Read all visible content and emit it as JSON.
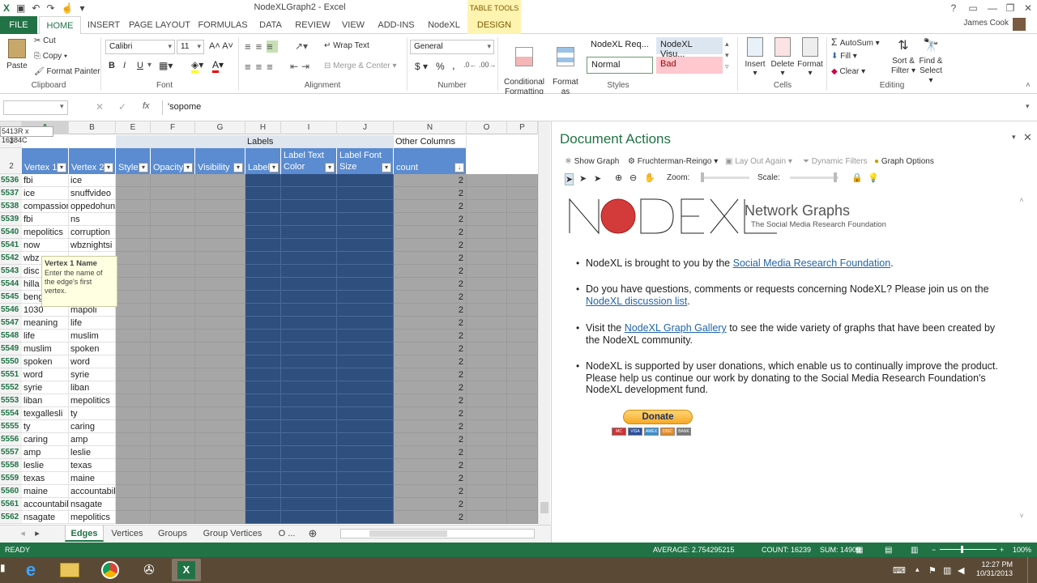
{
  "window": {
    "title": "NodeXLGraph2 - Excel",
    "table_tools": "TABLE TOOLS"
  },
  "tabs": [
    "FILE",
    "HOME",
    "INSERT",
    "PAGE LAYOUT",
    "FORMULAS",
    "DATA",
    "REVIEW",
    "VIEW",
    "ADD-INS",
    "NodeXL",
    "DESIGN"
  ],
  "user": "James Cook",
  "ribbon": {
    "clipboard": {
      "paste": "Paste",
      "cut": "Cut",
      "copy": "Copy",
      "format_painter": "Format Painter",
      "label": "Clipboard"
    },
    "font": {
      "name": "Calibri",
      "size": "11",
      "label": "Font",
      "bold": "B",
      "italic": "I",
      "underline": "U"
    },
    "alignment": {
      "wrap": "Wrap Text",
      "merge": "Merge & Center",
      "label": "Alignment"
    },
    "number": {
      "format": "General",
      "dollar": "$",
      "percent": "%",
      "comma": ",",
      "label": "Number"
    },
    "styles": {
      "cond": "Conditional\nFormatting",
      "format_table": "Format as\nTable",
      "s1": "NodeXL Req...",
      "s2": "NodeXL Visu...",
      "normal": "Normal",
      "bad": "Bad",
      "label": "Styles"
    },
    "cells": {
      "insert": "Insert",
      "delete": "Delete",
      "format": "Format",
      "label": "Cells"
    },
    "editing": {
      "autosum": "AutoSum",
      "fill": "Fill",
      "clear": "Clear",
      "sort": "Sort &\nFilter",
      "find": "Find &\nSelect",
      "label": "Editing"
    }
  },
  "formula_bar": {
    "name_box": "",
    "value": "'sopome",
    "fx": "fx"
  },
  "size_tip": "5413R x 16384C",
  "columns": [
    "A",
    "B",
    "E",
    "F",
    "G",
    "H",
    "I",
    "J",
    "N",
    "O",
    "P"
  ],
  "group_headers": {
    "labels": "Labels",
    "other": "Other Columns"
  },
  "table_headers": [
    "Vertex 1",
    "Vertex 2",
    "Style",
    "Opacity",
    "Visibility",
    "Label",
    "Label Text Color",
    "Label Font Size",
    "count"
  ],
  "rows": [
    [
      "5536",
      "fbi",
      "ice",
      "2"
    ],
    [
      "5537",
      "ice",
      "snuffvideo",
      "2"
    ],
    [
      "5538",
      "compassion",
      "oppedohun",
      "2"
    ],
    [
      "5539",
      "fbi",
      "ns",
      "2"
    ],
    [
      "5540",
      "mepolitics",
      "corruption",
      "2"
    ],
    [
      "5541",
      "now",
      "wbznightsi",
      "2"
    ],
    [
      "5542",
      "wbz",
      "",
      "2"
    ],
    [
      "5543",
      "disc",
      "",
      "2"
    ],
    [
      "5544",
      "hilla",
      "",
      "2"
    ],
    [
      "5545",
      "beng",
      "",
      "2"
    ],
    [
      "5546",
      "1030",
      "mapoli",
      "2"
    ],
    [
      "5547",
      "meaning",
      "life",
      "2"
    ],
    [
      "5548",
      "life",
      "muslim",
      "2"
    ],
    [
      "5549",
      "muslim",
      "spoken",
      "2"
    ],
    [
      "5550",
      "spoken",
      "word",
      "2"
    ],
    [
      "5551",
      "word",
      "syrie",
      "2"
    ],
    [
      "5552",
      "syrie",
      "liban",
      "2"
    ],
    [
      "5553",
      "liban",
      "mepolitics",
      "2"
    ],
    [
      "5554",
      "texgallesli",
      "ty",
      "2"
    ],
    [
      "5555",
      "ty",
      "caring",
      "2"
    ],
    [
      "5556",
      "caring",
      "amp",
      "2"
    ],
    [
      "5557",
      "amp",
      "leslie",
      "2"
    ],
    [
      "5558",
      "leslie",
      "texas",
      "2"
    ],
    [
      "5559",
      "texas",
      "maine",
      "2"
    ],
    [
      "5560",
      "maine",
      "accountabil",
      "2"
    ],
    [
      "5561",
      "accountabil",
      "nsagate",
      "2"
    ],
    [
      "5562",
      "nsagate",
      "mepolitics",
      "2"
    ]
  ],
  "tooltip": {
    "title": "Vertex 1 Name",
    "body": "Enter the name of the edge's first vertex."
  },
  "sheet_tabs": [
    "Edges",
    "Vertices",
    "Groups",
    "Group Vertices",
    "O ..."
  ],
  "status": {
    "ready": "READY",
    "average": "AVERAGE: 2.754295215",
    "count": "COUNT: 16239",
    "sum": "SUM: 14909",
    "zoom": "100%"
  },
  "doc": {
    "title": "Document Actions",
    "toolbar": {
      "show_graph": "Show Graph",
      "layout": "Fruchterman-Reingo",
      "layout_again": "Lay Out Again",
      "filters": "Dynamic Filters",
      "options": "Graph Options",
      "zoom": "Zoom:",
      "scale": "Scale:"
    },
    "logo_text": "NODEXL",
    "logo_title": "Network Graphs",
    "logo_sub": "The Social Media Research Foundation",
    "bullets": {
      "b1_pre": "NodeXL is brought to you by the ",
      "b1_link": "Social Media Research Foundation",
      "b1_post": ".",
      "b2_pre": "Do you have questions, comments or requests concerning NodeXL? Please join us on the ",
      "b2_link": "NodeXL discussion list",
      "b2_post": ".",
      "b3_pre": "Visit the ",
      "b3_link": "NodeXL Graph Gallery",
      "b3_post": " to see the wide variety of graphs that have been created by the NodeXL community.",
      "b4": "NodeXL is supported by user donations, which enable us to continually improve the product. Please help us continue our work by donating to the Social Media Research Foundation's NodeXL development fund."
    },
    "donate": "Donate",
    "cards": [
      "VISA",
      "MC",
      "AMEX",
      "DISC",
      "BANK"
    ]
  },
  "clock": {
    "time": "12:27 PM",
    "date": "10/31/2013"
  },
  "colors": {
    "excel_green": "#217346",
    "header_blue": "#5b8bd0",
    "dark_blue": "#2f4f7f",
    "gray_fill": "#a6a6a6"
  }
}
